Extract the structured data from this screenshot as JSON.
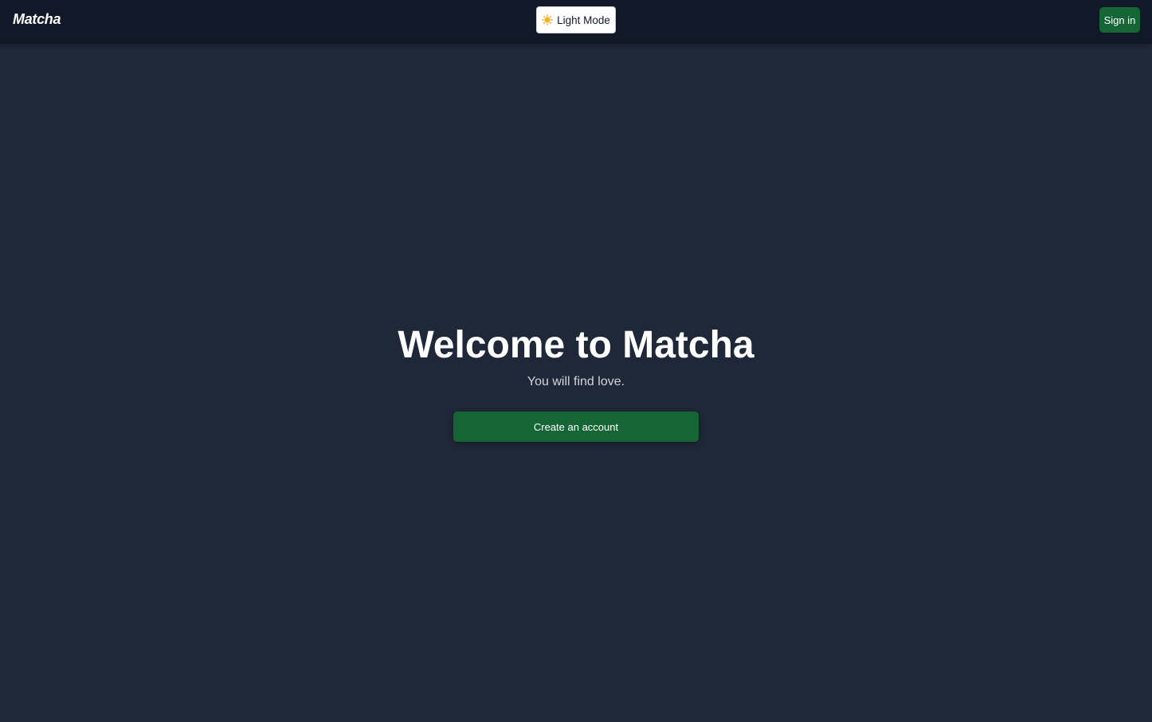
{
  "colors": {
    "navbar_bg": "#111827",
    "page_bg": "#1f2838",
    "accent_green": "#166534",
    "toggle_bg": "#ffffff",
    "sun_icon": "#f5b11e"
  },
  "navbar": {
    "brand": "Matcha",
    "theme_toggle": {
      "icon": "sun-icon",
      "label": "Light Mode"
    },
    "signin_label": "Sign in"
  },
  "hero": {
    "title": "Welcome to Matcha",
    "subtitle": "You will find love.",
    "cta_label": "Create an account"
  }
}
